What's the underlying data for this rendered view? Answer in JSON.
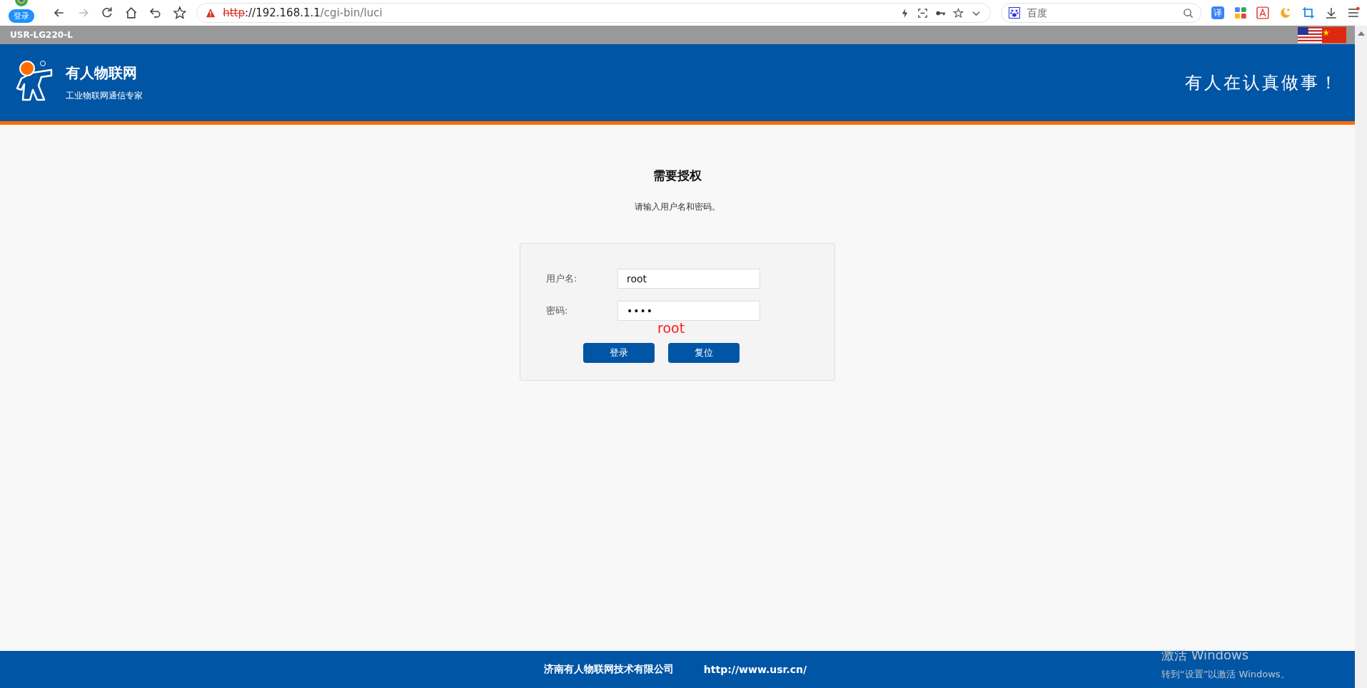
{
  "browser": {
    "profile_badge": "登录",
    "address": {
      "scheme": "http",
      "host": "://192.168.1.1",
      "path": "/cgi-bin/luci"
    },
    "search": {
      "placeholder": "百度"
    },
    "translate_icon": "译"
  },
  "device_bar": {
    "model": "USR-LG220-L"
  },
  "header": {
    "brand": "有人物联网",
    "tagline": "工业物联网通信专家",
    "slogan": "有人在认真做事！"
  },
  "login": {
    "title": "需要授权",
    "prompt": "请输入用户名和密码。",
    "fields": [
      {
        "label": "用户名:",
        "value": "root"
      },
      {
        "label": "密码:",
        "value": "••••"
      }
    ],
    "annotation": "root",
    "buttons": [
      "登录",
      "复位"
    ]
  },
  "footer": {
    "company": "济南有人物联网技术有限公司",
    "url": "http://www.usr.cn/"
  },
  "os_notice": {
    "title": "激活 Windows",
    "hint": "转到“设置”以激活 Windows。"
  }
}
